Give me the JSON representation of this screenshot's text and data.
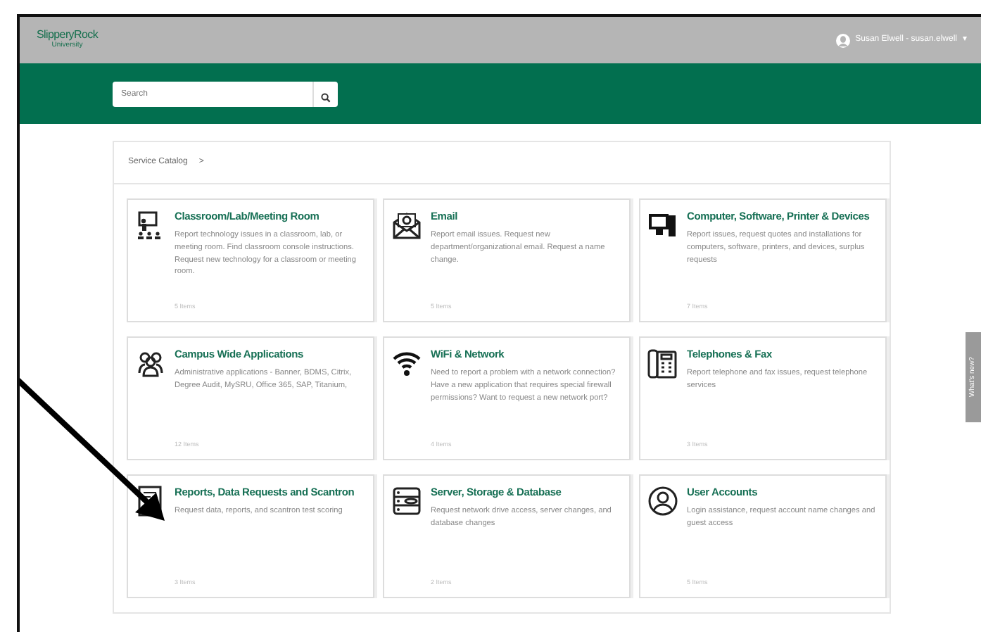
{
  "header": {
    "logo_name": "SlipperyRock",
    "logo_sub": "University",
    "user": "Susan Elwell - susan.elwell",
    "user_caret": "▾"
  },
  "search": {
    "placeholder": "Search"
  },
  "breadcrumb": {
    "label": "Service Catalog",
    "separator": ">"
  },
  "categories": [
    {
      "kind": "classroom",
      "title": "Classroom/Lab/Meeting Room",
      "description": "Report technology issues in a classroom, lab, or meeting room. Find classroom console instructions. Request new technology for a classroom or meeting room.",
      "count": "5 Items"
    },
    {
      "kind": "email",
      "title": "Email",
      "description": "Report email issues. Request new department/organizational email. Request a name change.",
      "count": "5 Items"
    },
    {
      "kind": "computer",
      "title": "Computer, Software, Printer & Devices",
      "description": "Report issues, request quotes and installations for computers, software, printers, and devices, surplus requests",
      "count": "7 Items"
    },
    {
      "kind": "people",
      "title": "Campus Wide Applications",
      "description": "Administrative applications - Banner, BDMS, Citrix, Degree Audit, MySRU, Office 365, SAP, Titanium,",
      "count": "12 Items"
    },
    {
      "kind": "wifi",
      "title": "WiFi & Network",
      "description": "Need to report a problem with a network connection? Have a new application that requires special firewall permissions? Want to request a new network port?",
      "count": "4 Items"
    },
    {
      "kind": "phone",
      "title": "Telephones & Fax",
      "description": "Report telephone and fax issues, request telephone services",
      "count": "3 Items"
    },
    {
      "kind": "report",
      "title": "Reports, Data Requests and Scantron",
      "description": "Request data, reports, and scantron test scoring",
      "count": "3 Items"
    },
    {
      "kind": "database",
      "title": "Server, Storage & Database",
      "description": "Request network drive access, server changes, and database changes",
      "count": "2 Items"
    },
    {
      "kind": "user",
      "title": "User Accounts",
      "description": "Login assistance, request account name changes and guest access",
      "count": "5 Items"
    }
  ],
  "side_tab": {
    "label": "What's new?"
  },
  "annotation": {
    "kind": "arrow"
  }
}
